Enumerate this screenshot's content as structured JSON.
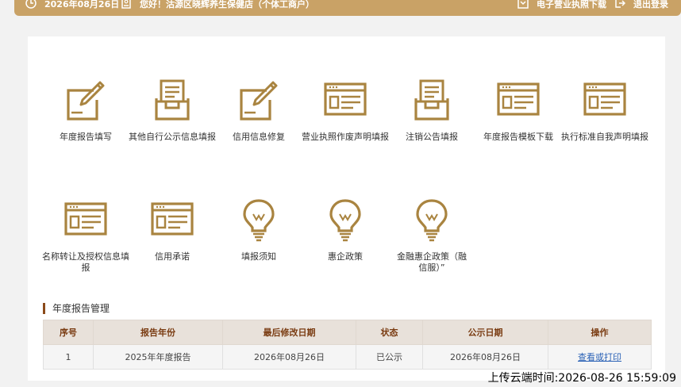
{
  "topbar": {
    "date": "2026年08月26日",
    "greeting": "您好！沽源区晓辉养生保健店（个体工商户）",
    "license_download": "电子营业执照下载",
    "logout": "退出登录"
  },
  "tiles_row1": [
    {
      "label": "年度报告填写",
      "icon": "edit-form-icon"
    },
    {
      "label": "其他自行公示信息填报",
      "icon": "inbox-document-icon"
    },
    {
      "label": "信用信息修复",
      "icon": "edit-form-icon"
    },
    {
      "label": "营业执照作废声明填报",
      "icon": "browser-window-icon"
    },
    {
      "label": "注销公告填报",
      "icon": "inbox-document-icon"
    },
    {
      "label": "年度报告模板下载",
      "icon": "browser-window-icon"
    },
    {
      "label": "执行标准自我声明填报",
      "icon": "browser-window-icon"
    }
  ],
  "tiles_row2": [
    {
      "label": "名称转让及授权信息填报",
      "icon": "browser-window-icon"
    },
    {
      "label": "信用承诺",
      "icon": "browser-window-icon"
    },
    {
      "label": "填报须知",
      "icon": "lightbulb-icon"
    },
    {
      "label": "惠企政策",
      "icon": "lightbulb-icon"
    },
    {
      "label": "金融惠企政策（融信服）”",
      "icon": "lightbulb-icon"
    }
  ],
  "section": {
    "title": "年度报告管理"
  },
  "table": {
    "headers": [
      "序号",
      "报告年份",
      "最后修改日期",
      "状态",
      "公示日期",
      "操作"
    ],
    "rows": [
      [
        "1",
        "2025年年度报告",
        "2026年08月26日",
        "已公示",
        "2026年08月26日",
        "查看或打印"
      ]
    ]
  },
  "upload_time": "上传云端时间:2026-08-26 15:59:09",
  "colors": {
    "accent": "#c9a266",
    "icon_gold": "#a98440",
    "header_text": "#7a3c12",
    "link": "#2b62b6"
  }
}
